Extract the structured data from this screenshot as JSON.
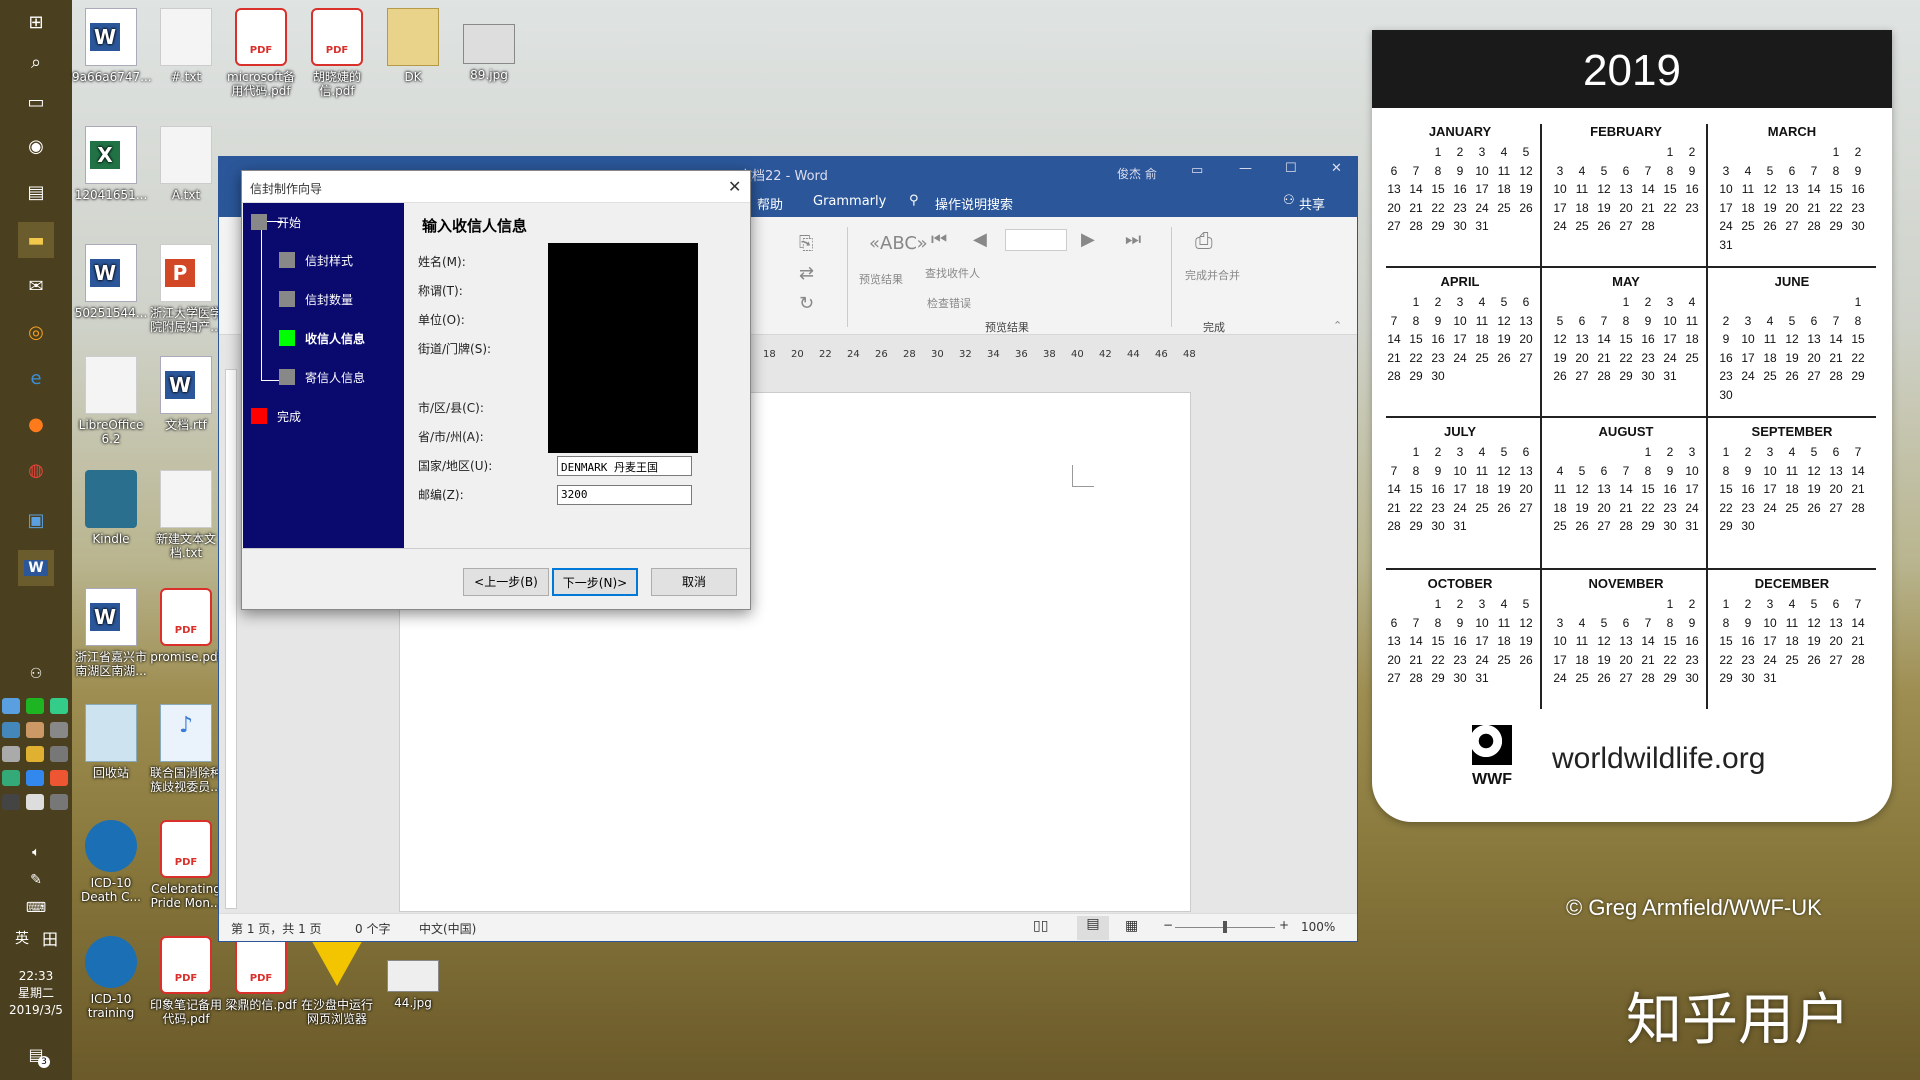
{
  "taskbar": {
    "time": "22:33",
    "weekday": "星期二",
    "date": "2019/3/5",
    "ime_lang": "英",
    "notification_count": "3"
  },
  "desktop": {
    "icons": [
      {
        "label": "9a66a6747...",
        "type": "word"
      },
      {
        "label": "#.txt",
        "type": "txt"
      },
      {
        "label": "microsoft备用代码.pdf",
        "type": "pdf"
      },
      {
        "label": "胡晓婕的信.pdf",
        "type": "pdf"
      },
      {
        "label": "DK",
        "type": "folder"
      },
      {
        "label": "89.jpg",
        "type": "image"
      },
      {
        "label": "12041651...",
        "type": "excel"
      },
      {
        "label": "A.txt",
        "type": "txt"
      },
      {
        "label": "50251544...",
        "type": "word"
      },
      {
        "label": "浙江大学医学院附属妇产...",
        "type": "ppt"
      },
      {
        "label": "LibreOffice 6.2",
        "type": "txt"
      },
      {
        "label": "文档.rtf",
        "type": "word"
      },
      {
        "label": "Kindle",
        "type": "app"
      },
      {
        "label": "新建文本文档.txt",
        "type": "txt"
      },
      {
        "label": "浙江省嘉兴市南湖区南湖...",
        "type": "word"
      },
      {
        "label": "promise.pdf",
        "type": "pdf"
      },
      {
        "label": "回收站",
        "type": "bin"
      },
      {
        "label": "联合国消除种族歧视委员...",
        "type": "mp3"
      },
      {
        "label": "ICD-10 Death C...",
        "type": "who"
      },
      {
        "label": "Celebrating Pride Mon...",
        "type": "pdf"
      },
      {
        "label": "ICD-10 training",
        "type": "who"
      },
      {
        "label": "印象笔记备用代码.pdf",
        "type": "pdf"
      },
      {
        "label": "梁鼎的信.pdf",
        "type": "pdf"
      },
      {
        "label": "在沙盘中运行网页浏览器",
        "type": "sandbox"
      },
      {
        "label": "44.jpg",
        "type": "image"
      }
    ]
  },
  "word": {
    "title": "文档22 - Word",
    "user": "俊杰 俞",
    "tabs": [
      "帮助",
      "Grammarly",
      "操作说明搜索",
      "共享"
    ],
    "ribbon": {
      "preview_results": "预览结果",
      "find_recipient": "查找收件人",
      "check_errors": "检查错误",
      "group_preview": "预览结果",
      "finish_merge": "完成并合并",
      "group_finish": "完成"
    },
    "ruler_ticks": [
      "18",
      "20",
      "22",
      "24",
      "26",
      "28",
      "30",
      "32",
      "34",
      "36",
      "38",
      "40",
      "42",
      "44",
      "46",
      "48"
    ],
    "status": {
      "page": "第 1 页，共 1 页",
      "words": "0 个字",
      "lang": "中文(中国)",
      "zoom": "100%"
    }
  },
  "dialog": {
    "title": "信封制作向导",
    "heading": "输入收信人信息",
    "steps": [
      {
        "label": "开始",
        "color": "#888888"
      },
      {
        "label": "信封样式",
        "color": "#888888"
      },
      {
        "label": "信封数量",
        "color": "#888888"
      },
      {
        "label": "收信人信息",
        "color": "#00ff00"
      },
      {
        "label": "寄信人信息",
        "color": "#888888"
      },
      {
        "label": "完成",
        "color": "#ff0000"
      }
    ],
    "fields": {
      "name": "姓名(M):",
      "title": "称谓(T):",
      "unit": "单位(O):",
      "street": "街道/门牌(S):",
      "city": "市/区/县(C):",
      "province": "省/市/州(A):",
      "country": "国家/地区(U):",
      "zip": "邮编(Z):"
    },
    "values": {
      "country": "DENMARK 丹麦王国",
      "zip": "3200"
    },
    "buttons": {
      "back": "<上一步(B)",
      "next": "下一步(N)>",
      "cancel": "取消"
    }
  },
  "calendar": {
    "year": "2019",
    "months": [
      {
        "name": "JANUARY",
        "offset": 2,
        "days": 31
      },
      {
        "name": "FEBRUARY",
        "offset": 5,
        "days": 28
      },
      {
        "name": "MARCH",
        "offset": 5,
        "days": 31
      },
      {
        "name": "APRIL",
        "offset": 1,
        "days": 30
      },
      {
        "name": "MAY",
        "offset": 3,
        "days": 31
      },
      {
        "name": "JUNE",
        "offset": 6,
        "days": 30
      },
      {
        "name": "JULY",
        "offset": 1,
        "days": 31
      },
      {
        "name": "AUGUST",
        "offset": 4,
        "days": 31
      },
      {
        "name": "SEPTEMBER",
        "offset": 0,
        "days": 30
      },
      {
        "name": "OCTOBER",
        "offset": 2,
        "days": 31
      },
      {
        "name": "NOVEMBER",
        "offset": 5,
        "days": 30
      },
      {
        "name": "DECEMBER",
        "offset": 0,
        "days": 31
      }
    ],
    "wwf_text": "WWF",
    "site": "worldwildlife.org"
  },
  "wallpaper": {
    "credit": "© Greg Armfield/WWF-UK",
    "watermark": "知乎用户"
  }
}
